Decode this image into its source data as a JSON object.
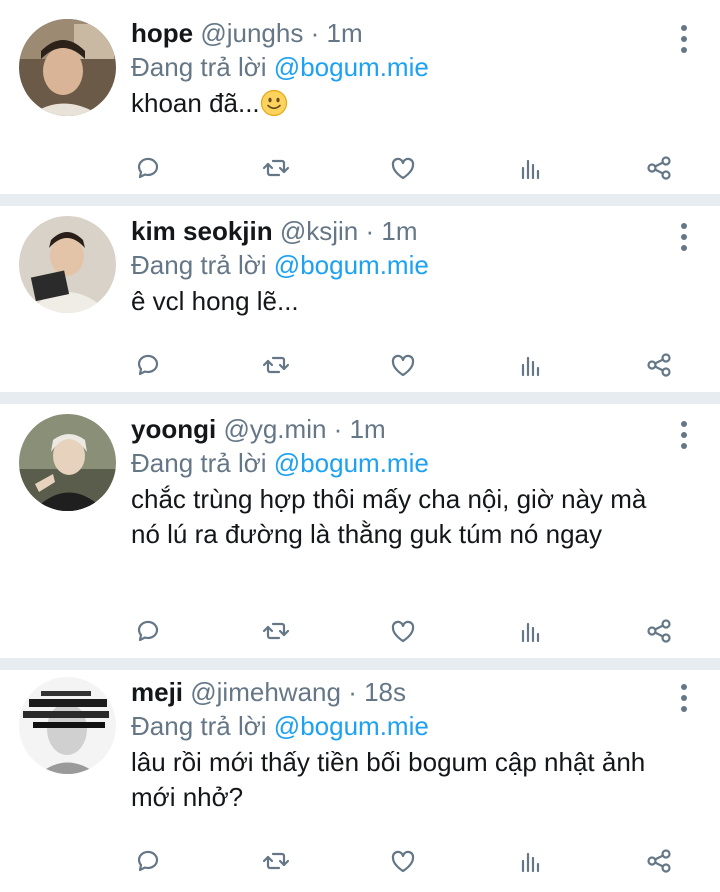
{
  "reply_prefix": "Đang trả lời",
  "tweets": [
    {
      "name": "hope",
      "handle": "@junghs",
      "separator": "·",
      "time": "1m",
      "reply_to": "@bogum.mie",
      "text": "khoan đã...",
      "emoji": "slightly-smiling-face"
    },
    {
      "name": "kim seokjin",
      "handle": "@ksjin",
      "separator": "·",
      "time": "1m",
      "reply_to": "@bogum.mie",
      "text": "ê vcl hong lẽ..."
    },
    {
      "name": "yoongi",
      "handle": "@yg.min",
      "separator": "·",
      "time": "1m",
      "reply_to": "@bogum.mie",
      "text": "chắc trùng hợp thôi mấy cha nội, giờ này mà nó lú ra đường là thằng guk túm nó ngay"
    },
    {
      "name": "meji",
      "handle": "@jimehwang",
      "separator": "·",
      "time": "18s",
      "reply_to": "@bogum.mie",
      "text": "lâu rồi mới thấy tiền bối bogum cập nhật ảnh mới nhở?"
    }
  ],
  "actions": [
    "reply-icon",
    "retweet-icon",
    "like-icon",
    "analytics-icon",
    "share-icon"
  ],
  "colors": {
    "link": "#1da1f2",
    "muted": "#657786",
    "separator": "#e6ecf0"
  }
}
